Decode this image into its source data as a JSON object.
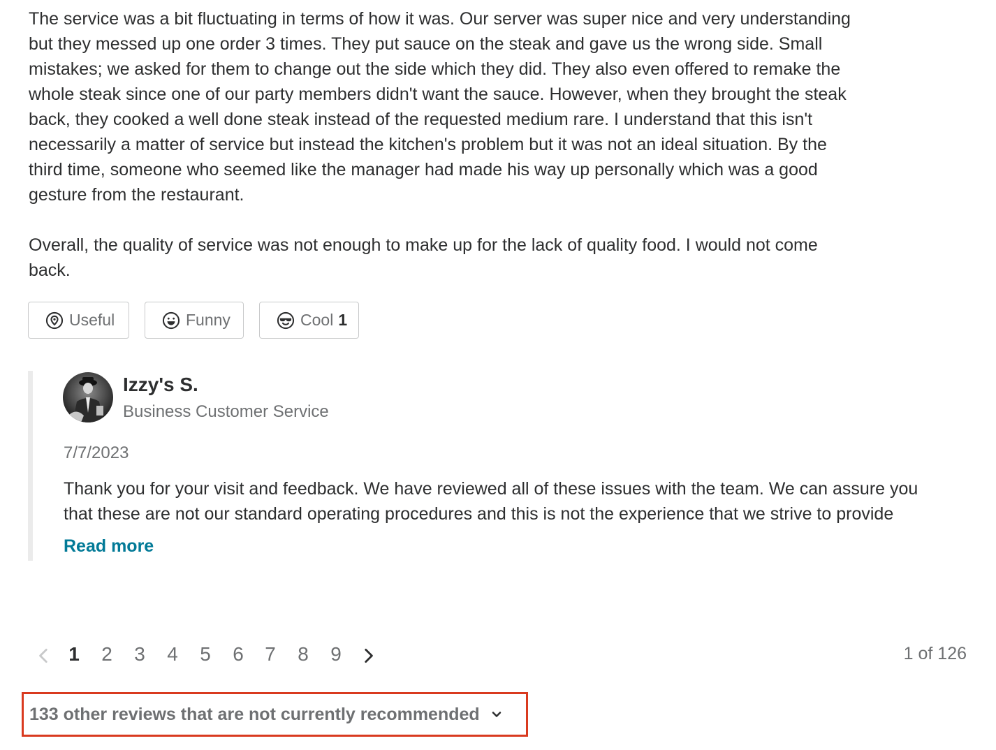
{
  "review": {
    "paragraphs": [
      "The service was a bit fluctuating in terms of how it was. Our server was super nice and very understanding but they messed up one order 3 times. They put sauce on the steak and gave us the wrong side. Small mistakes; we asked for them to change out the side which they did. They also even offered to remake the whole steak since one of our party members didn't want the sauce. However, when they brought the steak back, they cooked a well done steak instead of the requested medium rare. I understand that this isn't necessarily a matter of service but instead the kitchen's problem but it was not an ideal situation. By the third time, someone who seemed like the manager had made his way up personally which was a good gesture from the restaurant.",
      "Overall, the quality of service was not enough to make up for the lack of quality food. I would not come back."
    ]
  },
  "reactions": {
    "useful": {
      "label": "Useful",
      "icon": "useful-icon"
    },
    "funny": {
      "label": "Funny",
      "icon": "funny-icon"
    },
    "cool": {
      "label": "Cool",
      "count": "1",
      "icon": "cool-icon"
    }
  },
  "owner_reply": {
    "name": "Izzy's S.",
    "role": "Business Customer Service",
    "date": "7/7/2023",
    "text_line1": "Thank you for your visit and feedback. We have reviewed all of these issues with the team. We can assure you",
    "text_line2": "that these are not our standard operating procedures and this is not the experience that we strive to provide",
    "read_more": "Read more"
  },
  "pagination": {
    "pages": [
      "1",
      "2",
      "3",
      "4",
      "5",
      "6",
      "7",
      "8",
      "9"
    ],
    "current": "1",
    "status": "1 of 126"
  },
  "not_recommended": {
    "label": "133 other reviews that are not currently recommended"
  },
  "colors": {
    "link": "#027a97",
    "highlight_border": "#d93a1f",
    "muted_text": "#6e7072",
    "body_text": "#2d2e2f"
  }
}
